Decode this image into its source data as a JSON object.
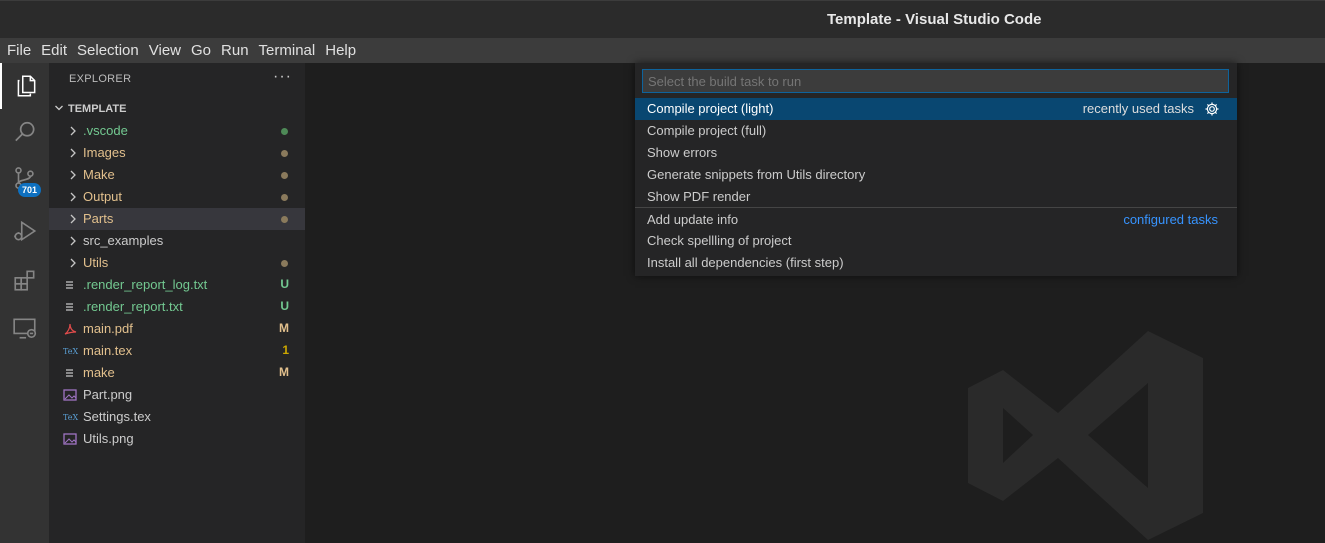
{
  "window": {
    "title": "Template - Visual Studio Code"
  },
  "menu": [
    "File",
    "Edit",
    "Selection",
    "View",
    "Go",
    "Run",
    "Terminal",
    "Help"
  ],
  "activity_bar": {
    "items": [
      "files-icon",
      "search-icon",
      "source-control-icon",
      "run-debug-icon",
      "extensions-icon",
      "remote-explorer-icon"
    ],
    "source_control_badge": "701"
  },
  "explorer": {
    "header": "EXPLORER",
    "more": "···",
    "section": "TEMPLATE",
    "tree": [
      {
        "label": ".vscode",
        "type": "folder",
        "color": "#73c991",
        "decoration": "dot",
        "deco_color": "#4e8a57"
      },
      {
        "label": "Images",
        "type": "folder",
        "color": "#e2c08d",
        "decoration": "dot",
        "deco_color": "#8a7a5c"
      },
      {
        "label": "Make",
        "type": "folder",
        "color": "#e2c08d",
        "decoration": "dot",
        "deco_color": "#8a7a5c"
      },
      {
        "label": "Output",
        "type": "folder",
        "color": "#e2c08d",
        "decoration": "dot",
        "deco_color": "#8a7a5c"
      },
      {
        "label": "Parts",
        "type": "folder",
        "color": "#e2c08d",
        "decoration": "dot",
        "deco_color": "#8a7a5c",
        "selected": true
      },
      {
        "label": "src_examples",
        "type": "folder",
        "color": "#cccccc",
        "decoration": ""
      },
      {
        "label": "Utils",
        "type": "folder",
        "color": "#e2c08d",
        "decoration": "dot",
        "deco_color": "#8a7a5c"
      },
      {
        "label": ".render_report_log.txt",
        "type": "text-file",
        "color": "#73c991",
        "decoration": "U",
        "deco_color": "#73c991"
      },
      {
        "label": ".render_report.txt",
        "type": "text-file",
        "color": "#73c991",
        "decoration": "U",
        "deco_color": "#73c991"
      },
      {
        "label": "main.pdf",
        "type": "pdf-file",
        "color": "#e2c08d",
        "decoration": "M",
        "deco_color": "#e2c08d"
      },
      {
        "label": "main.tex",
        "type": "tex-file",
        "color": "#e2c08d",
        "decoration": "1",
        "deco_color": "#cca700"
      },
      {
        "label": "make",
        "type": "text-file",
        "color": "#e2c08d",
        "decoration": "M",
        "deco_color": "#e2c08d"
      },
      {
        "label": "Part.png",
        "type": "image-file",
        "color": "#cccccc",
        "decoration": ""
      },
      {
        "label": "Settings.tex",
        "type": "tex-file",
        "color": "#cccccc",
        "decoration": ""
      },
      {
        "label": "Utils.png",
        "type": "image-file",
        "color": "#cccccc",
        "decoration": ""
      }
    ]
  },
  "quick_pick": {
    "placeholder": "Select the build task to run",
    "recent_label": "recently used tasks",
    "configured_label": "configured tasks",
    "items": [
      "Compile project (light)",
      "Compile project (full)",
      "Show errors",
      "Generate snippets from Utils directory",
      "Show PDF render",
      "Add update info",
      "Check spellling of project",
      "Install all dependencies (first step)"
    ]
  }
}
